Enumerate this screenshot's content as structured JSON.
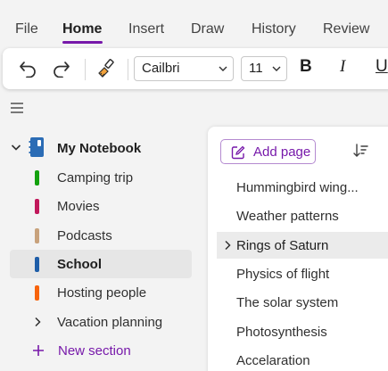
{
  "ribbon": {
    "tabs": [
      {
        "label": "File"
      },
      {
        "label": "Home"
      },
      {
        "label": "Insert"
      },
      {
        "label": "Draw"
      },
      {
        "label": "History"
      },
      {
        "label": "Review"
      }
    ],
    "active_tab": "Home"
  },
  "toolbar": {
    "font_name": "Cailbri",
    "font_size": "11",
    "bold_label": "B",
    "italic_label": "I",
    "underline_label": "U",
    "icons": [
      "undo-icon",
      "redo-icon",
      "format-painter-icon",
      "chevron-down-icon"
    ]
  },
  "navigation": {
    "notebook": {
      "name": "My Notebook",
      "color": "#2b6cb5"
    },
    "sections": [
      {
        "label": "Camping trip",
        "color": "#13a10e"
      },
      {
        "label": "Movies",
        "color": "#c1185b"
      },
      {
        "label": "Podcasts",
        "color": "#c8a27c"
      },
      {
        "label": "School",
        "color": "#1f5ea8"
      },
      {
        "label": "Hosting people",
        "color": "#f7630c"
      },
      {
        "label": "Vacation planning",
        "color": ""
      }
    ],
    "selected_section": "School",
    "new_section_label": "New section"
  },
  "pages": {
    "add_page_label": "Add page",
    "items": [
      {
        "label": "Hummingbird wing..."
      },
      {
        "label": "Weather patterns"
      },
      {
        "label": "Rings of Saturn"
      },
      {
        "label": "Physics of flight"
      },
      {
        "label": "The solar system"
      },
      {
        "label": "Photosynthesis"
      },
      {
        "label": "Accelaration"
      }
    ],
    "selected_page": "Rings of Saturn"
  },
  "colors": {
    "accent": "#7719aa",
    "background": "#f3f3f3",
    "panel": "#ffffff"
  }
}
